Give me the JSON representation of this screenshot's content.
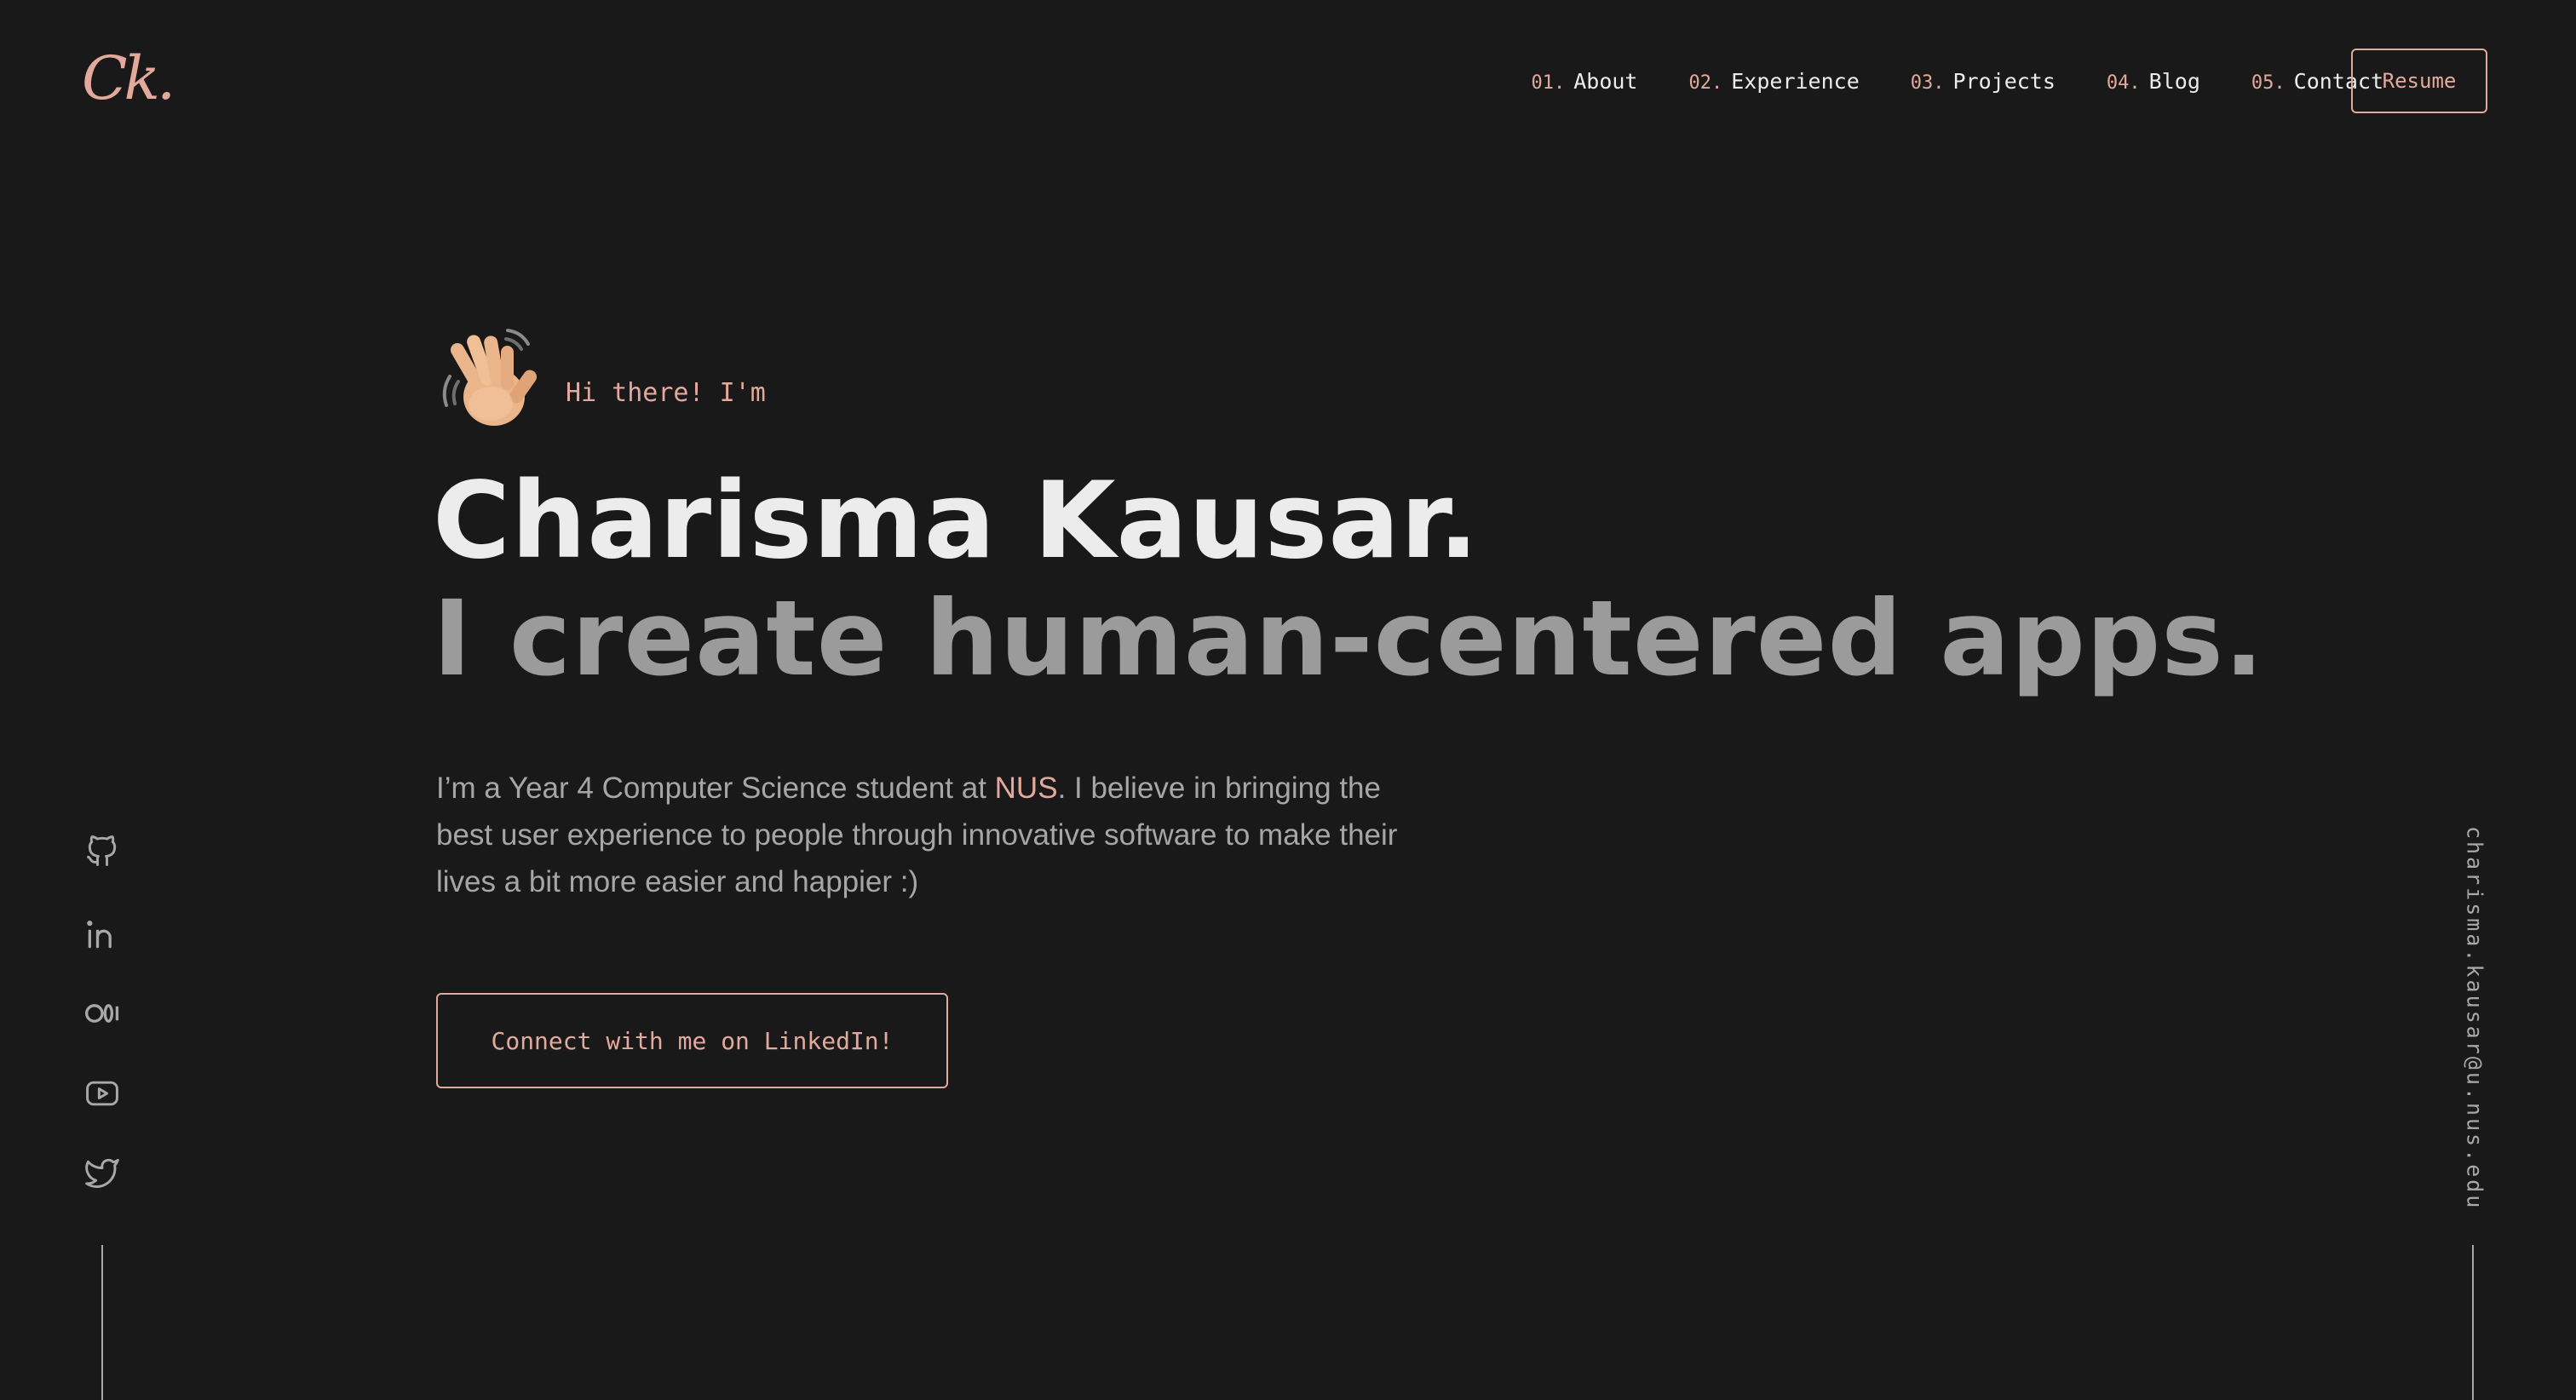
{
  "logo": {
    "text": "Ck."
  },
  "nav": {
    "items": [
      {
        "num": "01.",
        "label": "About"
      },
      {
        "num": "02.",
        "label": "Experience"
      },
      {
        "num": "03.",
        "label": "Projects"
      },
      {
        "num": "04.",
        "label": "Blog"
      },
      {
        "num": "05.",
        "label": "Contact"
      }
    ],
    "resume_label": "Resume"
  },
  "hero": {
    "greeting": "Hi there! I'm",
    "name": "Charisma Kausar.",
    "tagline": "I create human-centered apps.",
    "bio_before": "I’m a Year 4 Computer Science student at ",
    "bio_link": "NUS",
    "bio_after": ". I believe in bringing the best user experience to people through innovative software to make their lives a bit more easier and happier :)",
    "cta_label": "Connect with me on LinkedIn!",
    "emoji_icon": "waving-hand-icon"
  },
  "social": {
    "icons": [
      "github-icon",
      "linkedin-icon",
      "medium-icon",
      "youtube-icon",
      "twitter-icon"
    ]
  },
  "email": "charisma.kausar@u.nus.edu",
  "colors": {
    "background": "#191919",
    "accent": "#e3a99d",
    "text_primary": "#ececec",
    "text_secondary": "#9b9b9b"
  }
}
